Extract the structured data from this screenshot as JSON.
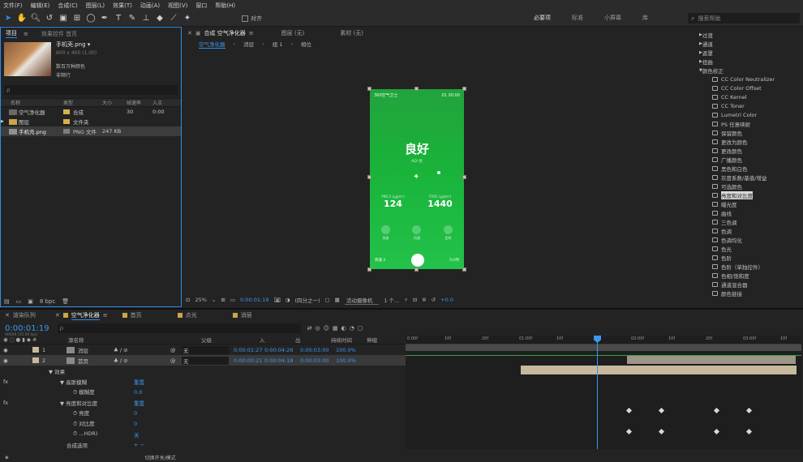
{
  "menu": [
    "文件(F)",
    "编辑(E)",
    "合成(C)",
    "图层(L)",
    "效果(T)",
    "动画(A)",
    "视图(V)",
    "窗口",
    "帮助(H)"
  ],
  "toolbar": {
    "align_label": "对齐",
    "workspaces": [
      "必要项",
      "标准",
      "小屏幕",
      "库"
    ],
    "search_placeholder": "搜索帮助"
  },
  "project": {
    "tab": "项目",
    "tab2": "效果控件 首页",
    "file_name": "手机壳.png ▾",
    "file_size": "600 x 400 (1.00)",
    "file_info1": "数百万种颜色",
    "file_info2": "非隔行",
    "search_placeholder": "ρ",
    "columns": [
      "名称",
      "类型",
      "大小",
      "帧速率",
      "入点"
    ],
    "rows": [
      {
        "name": "空气净化器",
        "type": "合成",
        "size": "",
        "fps": "30",
        "in": "0:00"
      },
      {
        "name": "图层",
        "type": "文件夹",
        "size": "",
        "fps": "",
        "in": ""
      },
      {
        "name": "手机壳.png",
        "type": "PNG 文件",
        "size": "247 KB",
        "fps": "",
        "in": ""
      }
    ],
    "bpc": "8 bpc"
  },
  "viewer": {
    "tab_comp": "合成 空气净化器",
    "tab_layer": "图层 (无)",
    "tab_footage": "素材 (无)",
    "breadcrumbs": [
      "空气净化器",
      "消层",
      "组 1",
      "相位"
    ],
    "zoom": "25%",
    "timecode": "0:00:01:19",
    "quality": "(四分之一)",
    "camera": "活动摄像机",
    "views": "1 个...",
    "exposure": "+0.0"
  },
  "phone": {
    "header_left": "360空气卫士",
    "header_right": "01 00:00",
    "status": "良好",
    "substatus": "AQI 优",
    "metric1_label": "PM2.5 (μg/m³)",
    "metric1_value": "124",
    "metric2_label": "TVOC (μg/m³)",
    "metric2_value": "1440",
    "icon_labels": [
      "风扇",
      "风速",
      "定时"
    ],
    "bottom_left": "风速 2",
    "bottom_right": "5小时"
  },
  "effects_panel": {
    "categories": [
      "过渡",
      "通道",
      "遮罩",
      "扭曲",
      "颜色校正"
    ],
    "items": [
      "CC Color Neutralizer",
      "CC Color Offset",
      "CC Kernel",
      "CC Toner",
      "Lumetri Color",
      "PS 任意映射",
      "保留颜色",
      "更改为颜色",
      "更改颜色",
      "广播颜色",
      "黑色和白色",
      "灰度系数/基值/增益",
      "可选颜色",
      "亮度和对比度",
      "曝光度",
      "曲线",
      "三色调",
      "色调",
      "色调均化",
      "色光",
      "色阶",
      "色阶（单独控件）",
      "色相/饱和度",
      "通道混合器",
      "颜色链接"
    ],
    "highlight_index": 13
  },
  "timeline": {
    "tab_queue": "渲染队列",
    "tab_comp": "空气净化器",
    "tab_home": "首页",
    "tab_dot": "点光",
    "tab_layer": "消层",
    "timecode": "0:00:01:19",
    "timecode_sub": "00049 (25.00 fps)",
    "search_placeholder": "ρ",
    "columns": [
      "源名称",
      "父级",
      "入",
      "出",
      "持续时间",
      "伸缩"
    ],
    "layers": [
      {
        "num": "1",
        "name": "消层",
        "parent": "无",
        "in": "0:00:01:27",
        "out": "0:00:04:26",
        "dur": "0:00:03:00",
        "stretch": "100.0%"
      },
      {
        "num": "2",
        "name": "首页",
        "parent": "无",
        "in": "0:00:00:21",
        "out": "0:00:04:18",
        "dur": "0:00:03:00",
        "stretch": "100.0%"
      }
    ],
    "props": [
      {
        "label": "效果"
      },
      {
        "label": "高斯模糊",
        "value": "重置"
      },
      {
        "label": "模糊度",
        "value": "0.0"
      },
      {
        "label": "亮度和对比度",
        "value": "重置"
      },
      {
        "label": "亮度",
        "value": "0"
      },
      {
        "label": "对比度",
        "value": "0"
      },
      {
        "label": "...HDR)",
        "value": "关"
      },
      {
        "label": "合成选项",
        "value": "+ −"
      }
    ],
    "ruler": [
      "0:00f",
      "10f",
      "20f",
      "01:00f",
      "10f",
      "20f",
      "02:00f",
      "10f",
      "20f",
      "03:00f",
      "10f"
    ],
    "footer": "切换开关/模式"
  }
}
